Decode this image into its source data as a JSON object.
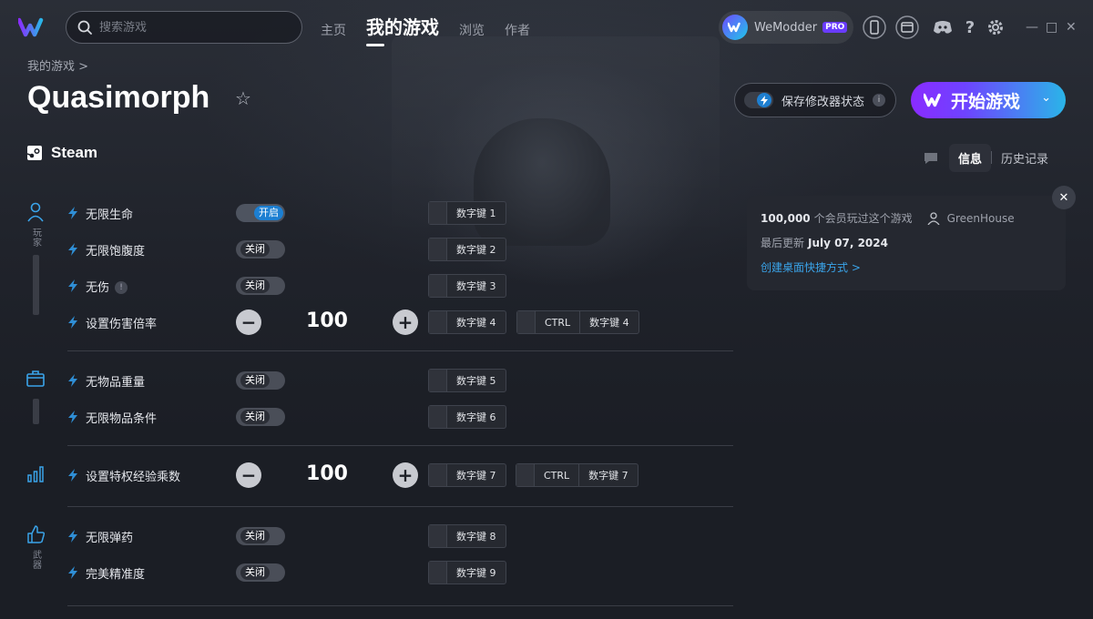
{
  "window": {
    "brand_colors": {
      "accent_purple": "#8a2bff",
      "accent_cyan": "#2ab5e8",
      "on_blue": "#1c7fd2",
      "link": "#3aa4ea"
    },
    "controls": [
      "—",
      "□",
      "✕"
    ]
  },
  "topbar": {
    "search_placeholder": "搜索游戏",
    "nav": [
      {
        "label": "主页",
        "active": false
      },
      {
        "label": "我的游戏",
        "active": true
      },
      {
        "label": "浏览",
        "active": false
      },
      {
        "label": "作者",
        "active": false
      }
    ],
    "user": {
      "name": "WeModder",
      "badge": "PRO"
    },
    "icons": [
      "phone-icon",
      "overlay-icon",
      "discord-icon",
      "help-icon",
      "gear-icon"
    ],
    "help_glyph": "?"
  },
  "header": {
    "breadcrumb": "我的游戏 >",
    "title": "Quasimorph",
    "platform": "Steam",
    "save_state_label": "保存修改器状态",
    "info_glyph": "i",
    "play_label": "开始游戏"
  },
  "right_tabs": [
    "信息",
    "历史记录"
  ],
  "info_panel": {
    "players_count": "100,000",
    "players_suffix": "个会员玩过这个游戏",
    "author": "GreenHouse",
    "updated_label": "最后更新",
    "updated_date": "July 07, 2024",
    "shortcut_link": "创建桌面快捷方式 >"
  },
  "categories": [
    {
      "label": "玩家",
      "icon": "person-icon"
    },
    {
      "label": "",
      "icon": "box-icon"
    },
    {
      "label": "",
      "icon": "stats-icon"
    },
    {
      "label": "武器",
      "icon": "thumbs-up-icon"
    }
  ],
  "cheats": [
    {
      "label": "无限生命",
      "type": "toggle",
      "state": "开启",
      "on": true,
      "key": "数字键 1"
    },
    {
      "label": "无限饱腹度",
      "type": "toggle",
      "state": "关闭",
      "on": false,
      "key": "数字键 2"
    },
    {
      "label": "无伤",
      "type": "toggle",
      "state": "关闭",
      "on": false,
      "key": "数字键 3",
      "warn": "!"
    },
    {
      "label": "设置伤害倍率",
      "type": "stepper",
      "value": "100",
      "minus": "−",
      "plus": "+",
      "key": "数字键 4",
      "alt_mod": "CTRL",
      "alt_key": "数字键 4"
    },
    {
      "label": "无物品重量",
      "type": "toggle",
      "state": "关闭",
      "on": false,
      "key": "数字键 5"
    },
    {
      "label": "无限物品条件",
      "type": "toggle",
      "state": "关闭",
      "on": false,
      "key": "数字键 6"
    },
    {
      "label": "设置特权经验乘数",
      "type": "stepper",
      "value": "100",
      "minus": "−",
      "plus": "+",
      "key": "数字键 7",
      "alt_mod": "CTRL",
      "alt_key": "数字键 7"
    },
    {
      "label": "无限弹药",
      "type": "toggle",
      "state": "关闭",
      "on": false,
      "key": "数字键 8"
    },
    {
      "label": "完美精准度",
      "type": "toggle",
      "state": "关闭",
      "on": false,
      "key": "数字键 9"
    }
  ]
}
